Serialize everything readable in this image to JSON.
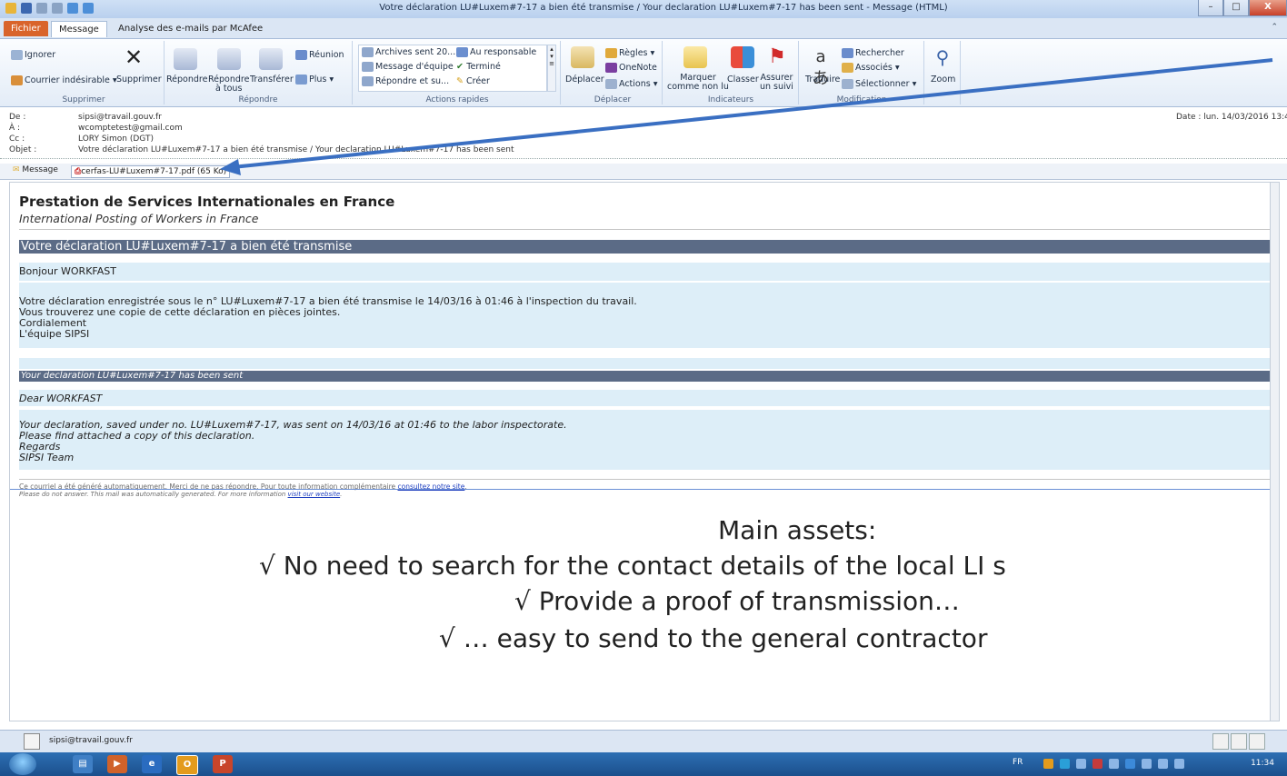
{
  "window": {
    "title": "Votre déclaration LU#Luxem#7-17 a bien été transmise / Your declaration LU#Luxem#7-17 has been sent  -  Message (HTML)",
    "controls": {
      "minimize": "–",
      "maximize": "□",
      "close": "X"
    }
  },
  "tabs": [
    {
      "label": "Fichier"
    },
    {
      "label": "Message"
    },
    {
      "label": "Analyse des e-mails par McAfee"
    }
  ],
  "ribbon": {
    "supprimer": {
      "ignore": "Ignorer",
      "junk": "Courrier indésirable",
      "delete": "Supprimer",
      "label": "Supprimer"
    },
    "repondre": {
      "reply": "Répondre",
      "reply_all_1": "Répondre",
      "reply_all_2": "à tous",
      "forward": "Transférer",
      "meeting": "Réunion",
      "more": "Plus",
      "label": "Répondre"
    },
    "actions_rapides": {
      "items": [
        "Archives sent 20...",
        "Message d'équipe",
        "Répondre et su...",
        "Au responsable",
        "Terminé",
        "Créer"
      ],
      "label": "Actions rapides"
    },
    "deplacer": {
      "move": "Déplacer",
      "rules": "Règles",
      "onenote": "OneNote",
      "actions": "Actions",
      "label": "Déplacer"
    },
    "indicateurs": {
      "mark_1": "Marquer",
      "mark_2": "comme non lu",
      "classify": "Classer",
      "follow_1": "Assurer",
      "follow_2": "un suivi",
      "label": "Indicateurs"
    },
    "modification": {
      "translate": "Traduire",
      "search": "Rechercher",
      "related": "Associés",
      "select": "Sélectionner",
      "label": "Modification"
    },
    "zoom": {
      "label": "Zoom"
    }
  },
  "header": {
    "from_label": "De :",
    "from": "sipsi@travail.gouv.fr",
    "to_label": "À :",
    "to": "wcomptetest@gmail.com",
    "cc_label": "Cc :",
    "cc": "LORY Simon (DGT)",
    "subject_label": "Objet :",
    "subject": "Votre déclaration LU#Luxem#7-17 a bien été transmise / Your declaration LU#Luxem#7-17 has been sent",
    "date_label": "Date :",
    "date": "lun. 14/03/2016 13:4"
  },
  "attachments": {
    "message_tab": "Message",
    "pdf": "cerfas-LU#Luxem#7-17.pdf (65 Ko)"
  },
  "email": {
    "title": "Prestation de Services Internationales en France",
    "subtitle": "International Posting of Workers in France",
    "fr_bar": "Votre déclaration LU#Luxem#7-17 a bien été transmise",
    "fr_greeting": "Bonjour WORKFAST",
    "fr_lines": [
      "Votre déclaration enregistrée sous le n° LU#Luxem#7-17 a bien été transmise le 14/03/16 à 01:46 à l'inspection du travail.",
      "Vous trouverez une copie de cette déclaration en pièces jointes.",
      "Cordialement",
      "L'équipe SIPSI"
    ],
    "en_bar": "Your declaration LU#Luxem#7-17 has been sent",
    "en_greeting": "Dear WORKFAST",
    "en_lines": [
      "Your declaration, saved under no. LU#Luxem#7-17, was sent on 14/03/16 at 01:46 to the labor inspectorate.",
      "Please find attached a copy of this declaration.",
      "Regards",
      "SIPSI Team"
    ],
    "footer_fr": "Ce courriel a été généré automatiquement. Merci de ne pas répondre. Pour toute information complémentaire ",
    "footer_fr_link": "consultez notre site",
    "footer_fr_end": ".",
    "footer_en": "Please do not answer. This mail was automatically generated. For more information ",
    "footer_en_link": "visit our website",
    "footer_en_end": "."
  },
  "slide_overlay": {
    "heading": "Main assets:",
    "bullets": [
      "√   No need to search for the contact details of the local LI s",
      "√   Provide a proof of transmission…",
      "√   … easy to send to the general contractor"
    ]
  },
  "status_bar": {
    "email": "sipsi@travail.gouv.fr"
  },
  "taskbar": {
    "lang": "FR",
    "time": "11:34"
  },
  "colors": {
    "bar": "#5b6b86",
    "light_block": "#ddeef8",
    "arrow": "#3a6fc2",
    "file_tab": "#d9642b"
  }
}
